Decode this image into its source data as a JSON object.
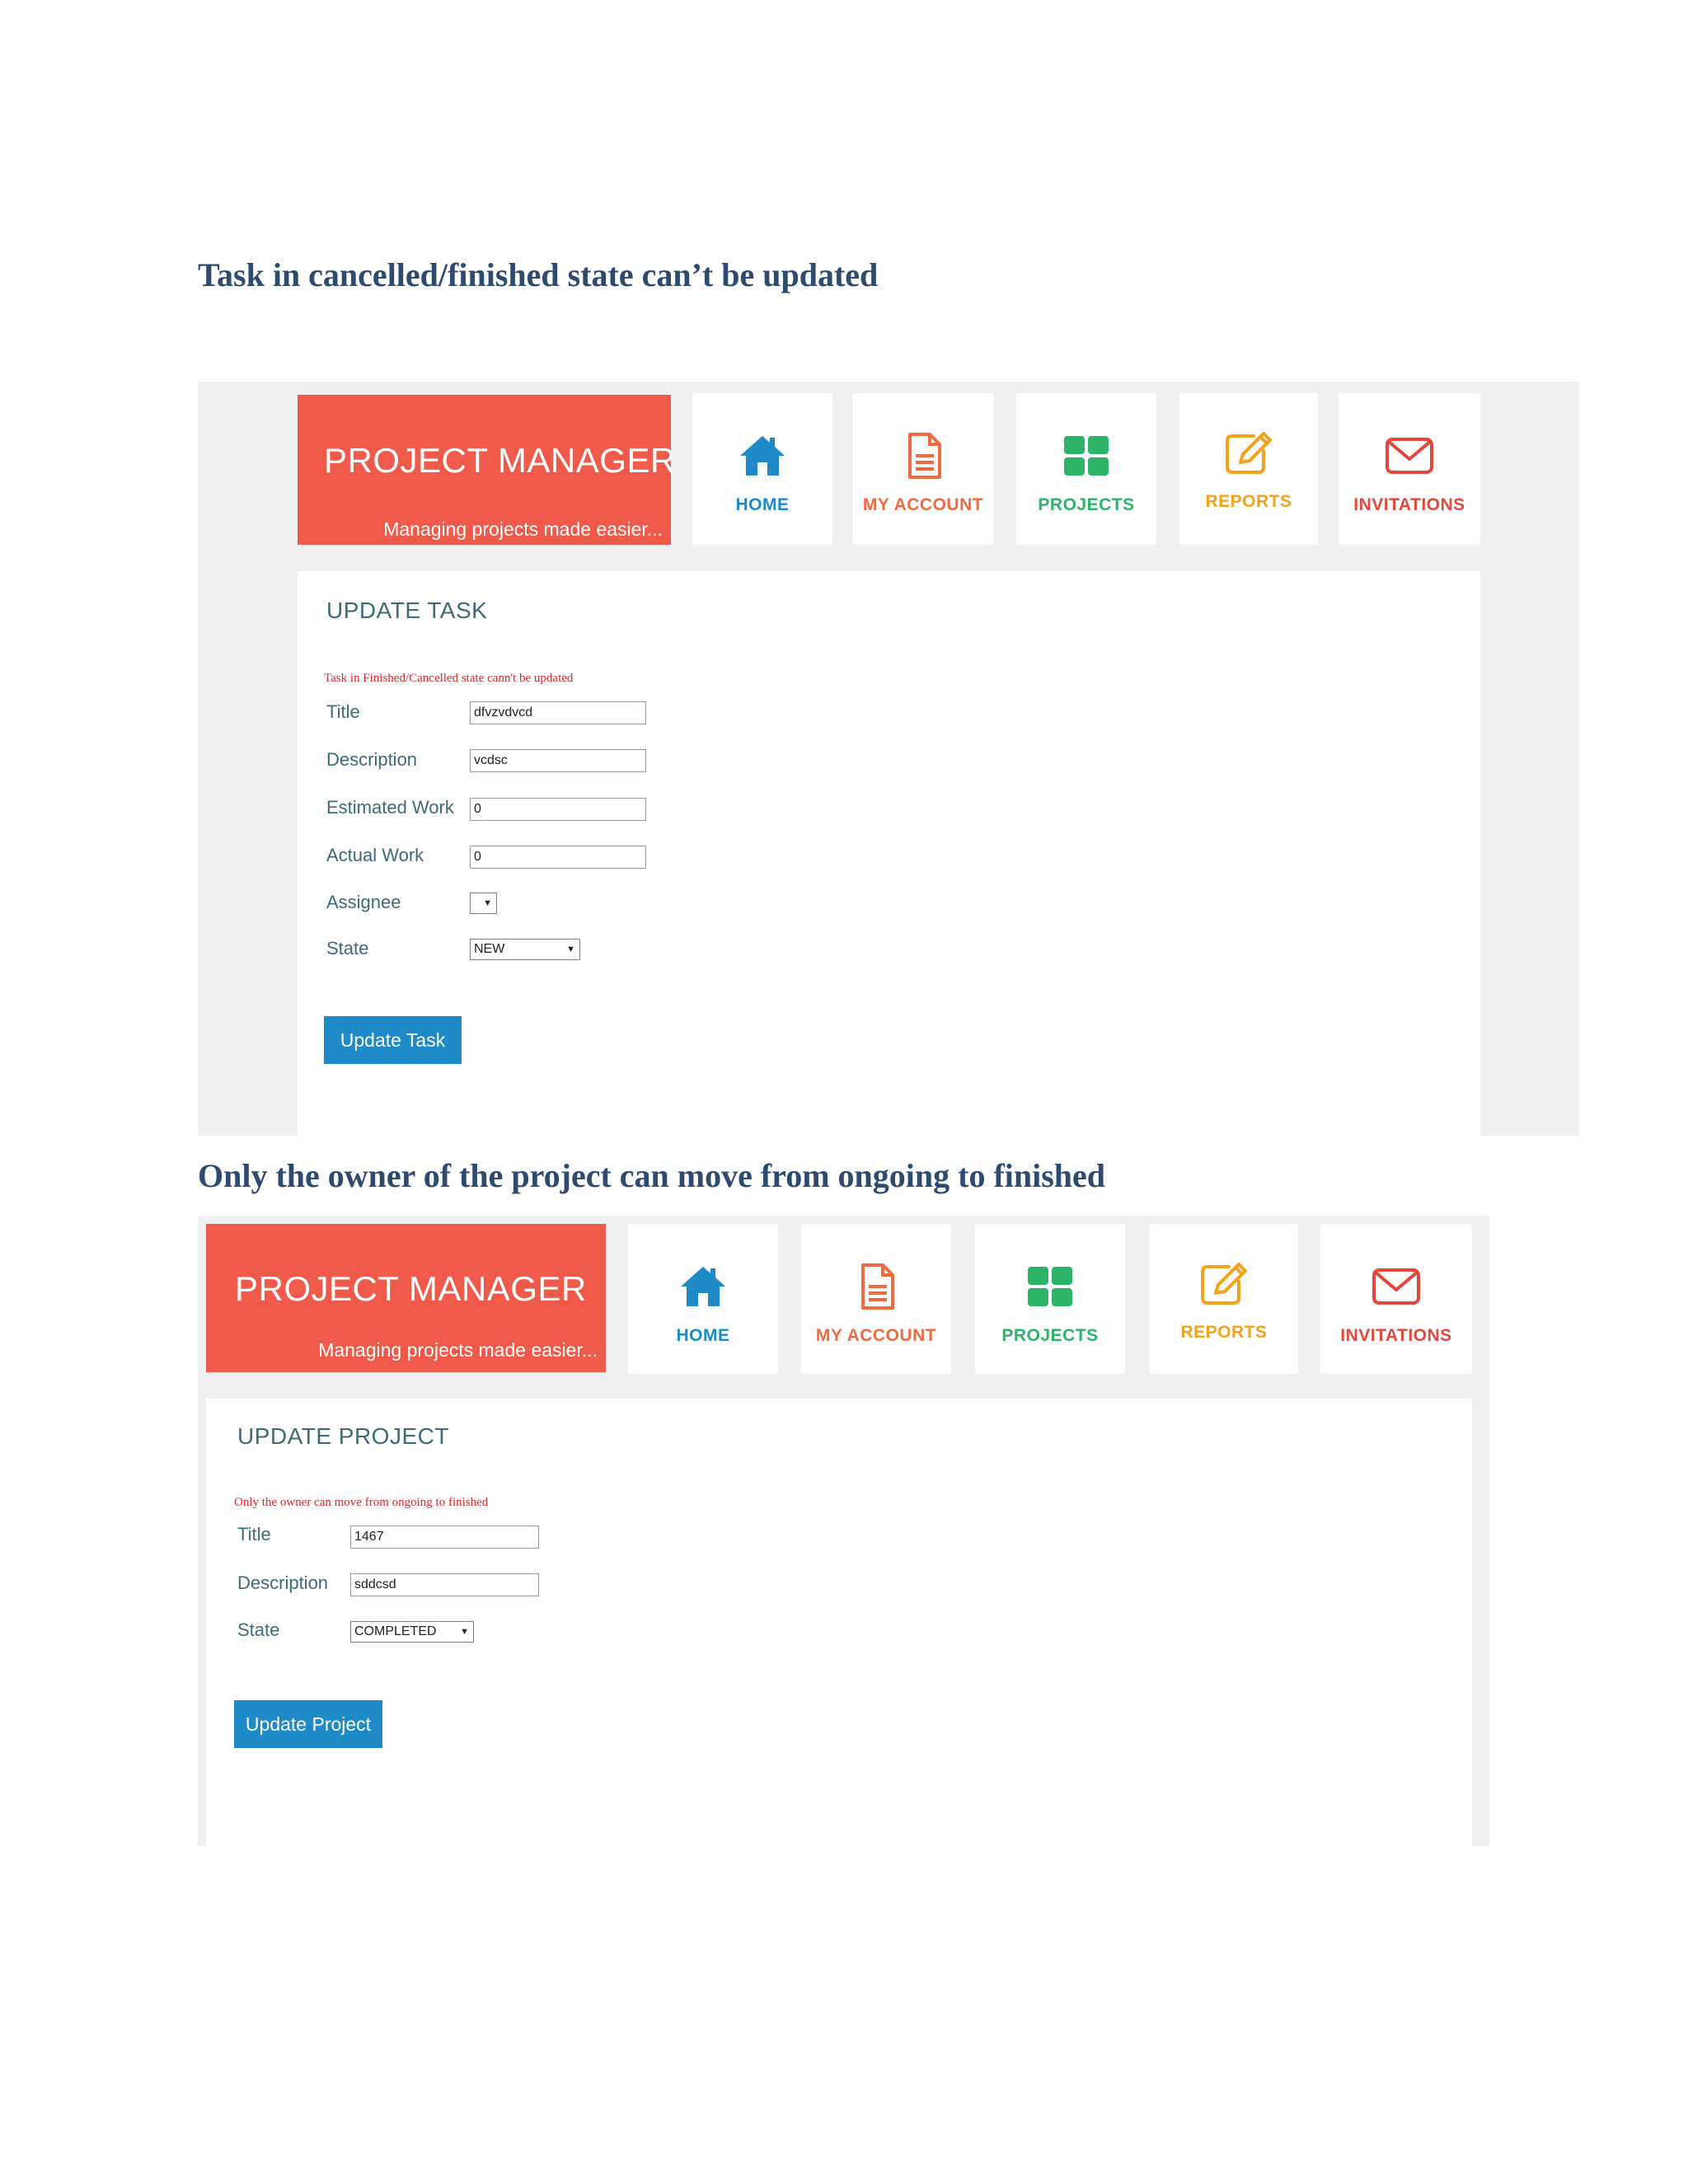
{
  "section1": {
    "heading": "Task in cancelled/finished state can’t be updated",
    "brand": {
      "title": "PROJECT MANAGER",
      "tagline": "Managing projects made easier..."
    },
    "nav": [
      {
        "label": "HOME",
        "icon": "home-icon",
        "color": "#1f8ac8"
      },
      {
        "label": "MY ACCOUNT",
        "icon": "document-icon",
        "color": "#f26a3f"
      },
      {
        "label": "PROJECTS",
        "icon": "grid-icon",
        "color": "#2db46a"
      },
      {
        "label": "REPORTS",
        "icon": "edit-icon",
        "color": "#f5a21b"
      },
      {
        "label": "INVITATIONS",
        "icon": "envelope-icon",
        "color": "#e5473d"
      }
    ],
    "panel_title": "UPDATE TASK",
    "error": "Task in Finished/Cancelled state cann't be updated",
    "fields": {
      "title": {
        "label": "Title",
        "value": "dfvzvdvcd"
      },
      "description": {
        "label": "Description",
        "value": "vcdsc"
      },
      "estimated_work": {
        "label": "Estimated Work",
        "value": "0"
      },
      "actual_work": {
        "label": "Actual Work",
        "value": "0"
      },
      "assignee": {
        "label": "Assignee",
        "value": ""
      },
      "state": {
        "label": "State",
        "value": "NEW"
      }
    },
    "button": "Update Task"
  },
  "section2": {
    "heading": "Only the owner of the project can move from ongoing to finished",
    "brand": {
      "title": "PROJECT MANAGER",
      "tagline": "Managing projects made easier..."
    },
    "nav": [
      {
        "label": "HOME",
        "icon": "home-icon",
        "color": "#1f8ac8"
      },
      {
        "label": "MY ACCOUNT",
        "icon": "document-icon",
        "color": "#f26a3f"
      },
      {
        "label": "PROJECTS",
        "icon": "grid-icon",
        "color": "#2db46a"
      },
      {
        "label": "REPORTS",
        "icon": "edit-icon",
        "color": "#f5a21b"
      },
      {
        "label": "INVITATIONS",
        "icon": "envelope-icon",
        "color": "#e5473d"
      }
    ],
    "panel_title": "UPDATE PROJECT",
    "error": "Only the owner can move from ongoing to finished",
    "fields": {
      "title": {
        "label": "Title",
        "value": "1467"
      },
      "description": {
        "label": "Description",
        "value": "sddcsd"
      },
      "state": {
        "label": "State",
        "value": "COMPLETED"
      }
    },
    "button": "Update Project"
  },
  "colors": {
    "brand": "#f05a4a",
    "heading": "#2e4a6e",
    "label": "#3d6b78",
    "error": "#e0262b",
    "button": "#1f8ac8",
    "screenshot_bg": "#efeef0"
  }
}
